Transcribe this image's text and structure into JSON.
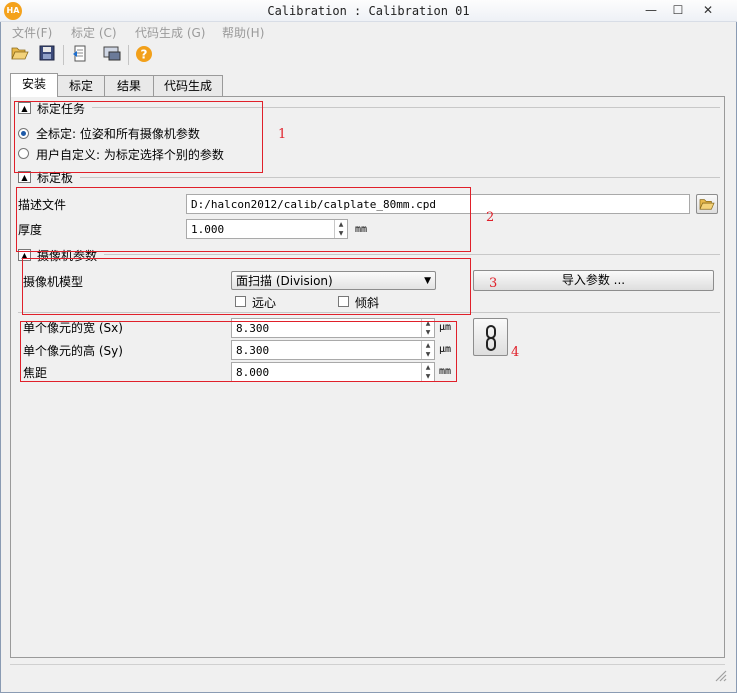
{
  "window": {
    "logo": "HA",
    "title": "Calibration : Calibration 01",
    "controls": {
      "minimize": "—",
      "maximize": "☐",
      "close": "✕"
    }
  },
  "menu": [
    "文件(F)",
    "标定 (C)",
    "代码生成 (G)",
    "帮助(H)"
  ],
  "toolbar": {
    "open_icon": "folder-open-icon",
    "save_icon": "save-icon",
    "export_icon": "export-icon",
    "screenshot_icon": "screenshot-icon",
    "help_icon": "help-icon",
    "help_glyph": "?"
  },
  "tabs": [
    "安装",
    "标定",
    "结果",
    "代码生成"
  ],
  "active_tab": "安装",
  "sections": {
    "task": {
      "title": "标定任务",
      "options": [
        "全标定: 位姿和所有摄像机参数",
        "用户自定义: 为标定选择个别的参数"
      ],
      "selected": 0
    },
    "plate": {
      "title": "标定板",
      "desc_label": "描述文件",
      "desc_value": "D:/halcon2012/calib/calplate_80mm.cpd",
      "thickness_label": "厚度",
      "thickness_value": "1.000",
      "thickness_unit": "mm"
    },
    "camera": {
      "title": "摄像机参数",
      "model_label": "摄像机模型",
      "model_value": "面扫描 (Division)",
      "telecentric_label": "远心",
      "tilt_label": "倾斜",
      "import_button": "导入参数 ...",
      "sx_label": "单个像元的宽 (Sx)",
      "sx_value": "8.300",
      "sx_unit": "µm",
      "sy_label": "单个像元的高 (Sy)",
      "sy_value": "8.300",
      "sy_unit": "µm",
      "focal_label": "焦距",
      "focal_value": "8.000",
      "focal_unit": "mm"
    }
  },
  "annotations": [
    "1",
    "2",
    "3",
    "4"
  ],
  "colors": {
    "annotation": "#e0202a",
    "radio_selected": "#1e5aa8",
    "logo": "#f4a21c",
    "help": "#f2a01a"
  }
}
